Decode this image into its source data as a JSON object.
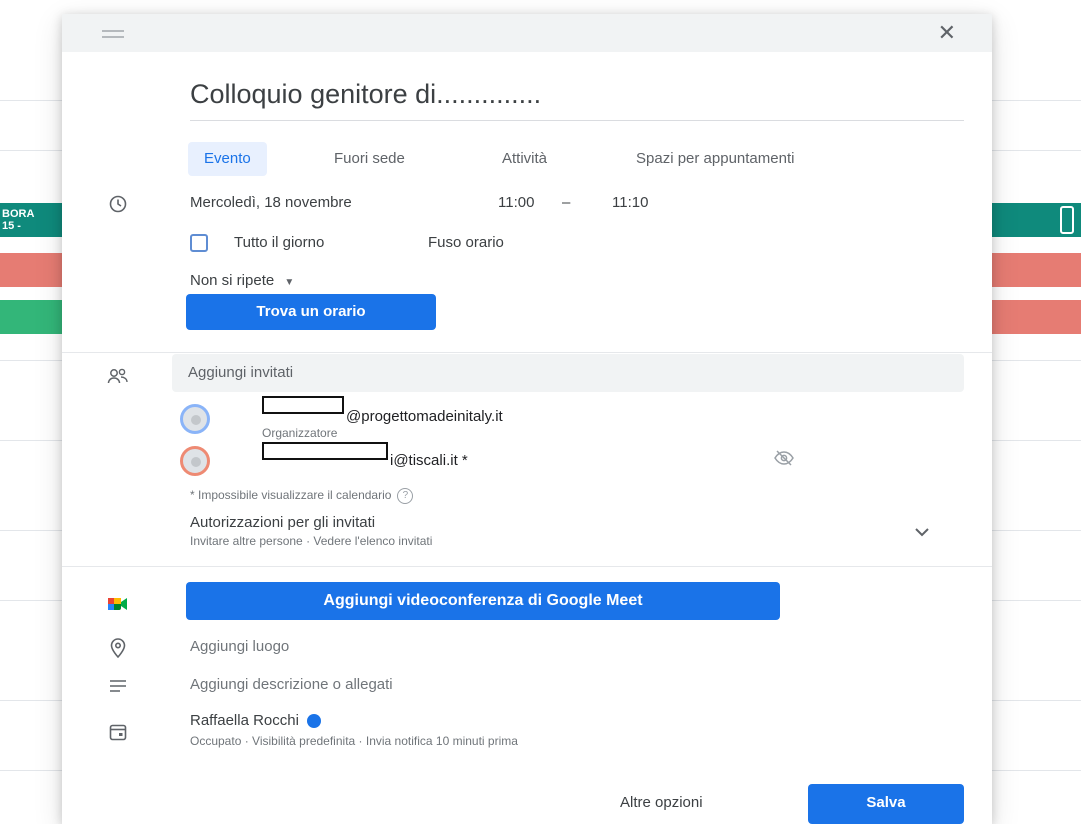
{
  "background": {
    "left_event_line1": "BORA",
    "left_event_line2": "15 -"
  },
  "event_dialog": {
    "title": "Colloquio genitore di..............",
    "tabs": [
      {
        "label": "Evento",
        "active": true
      },
      {
        "label": "Fuori sede",
        "active": false
      },
      {
        "label": "Attività",
        "active": false
      },
      {
        "label": "Spazi per appuntamenti",
        "active": false
      }
    ],
    "date": "Mercoledì, 18 novembre",
    "start_time": "11:00",
    "time_separator": "–",
    "end_time": "11:10",
    "all_day_label": "Tutto il giorno",
    "all_day_checked": false,
    "timezone_label": "Fuso orario",
    "repeat_label": "Non si ripete",
    "find_time_button": "Trova un orario",
    "guests": {
      "placeholder": "Aggiungi invitati",
      "list": [
        {
          "email_visible": "@progettomadeinitaly.it",
          "role": "Organizzatore"
        },
        {
          "email_visible": "i@tiscali.it *",
          "role": ""
        }
      ],
      "calendar_unavailable_note": "* Impossibile visualizzare il calendario",
      "permissions_title": "Autorizzazioni per gli invitati",
      "permissions_summary": "Invitare altre persone · Vedere l'elenco invitati"
    },
    "meet_button": "Aggiungi videoconferenza di Google Meet",
    "location_placeholder": "Aggiungi luogo",
    "description_placeholder": "Aggiungi descrizione o allegati",
    "calendar_owner": "Raffaella Rocchi",
    "calendar_details": "Occupato · Visibilità predefinita · Invia notifica 10 minuti prima",
    "more_options_button": "Altre opzioni",
    "save_button": "Salva"
  },
  "colors": {
    "accent": "#1a73e8",
    "tab_active_bg": "#e8f0fe",
    "bg_event_teal": "#0b8043",
    "bg_event_red": "#e67c73",
    "bg_event_green": "#33b679"
  }
}
